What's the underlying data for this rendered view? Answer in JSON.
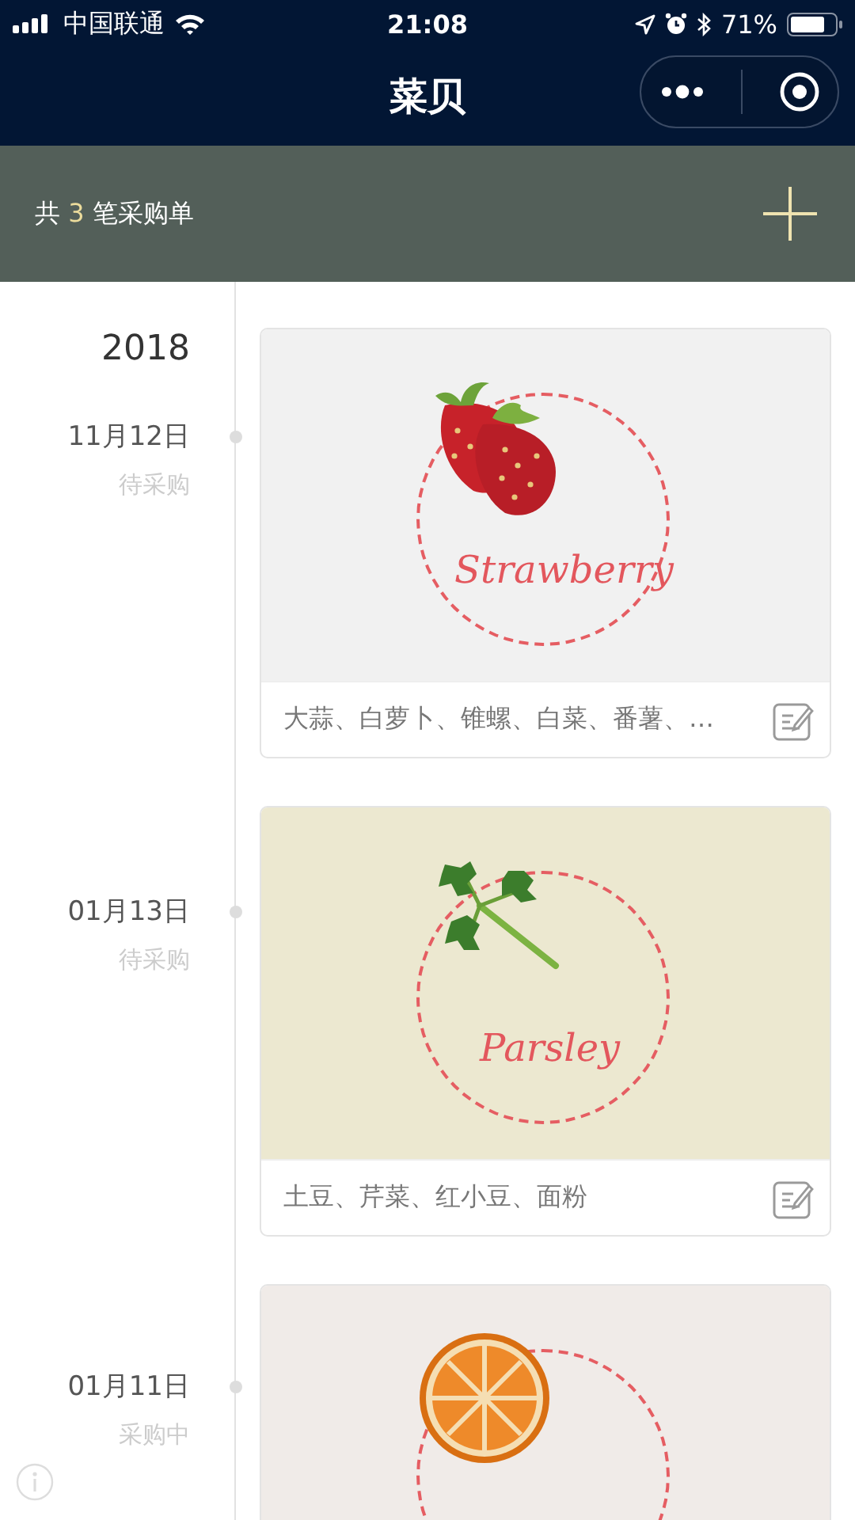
{
  "status_bar": {
    "carrier": "中国联通",
    "time": "21:08",
    "battery": "71%"
  },
  "nav": {
    "title": "菜贝"
  },
  "summary": {
    "prefix": "共",
    "count": "3",
    "suffix": "笔采购单"
  },
  "timeline": {
    "year": "2018",
    "orders": [
      {
        "date": "11月12日",
        "status": "待采购",
        "kind": "strawberry",
        "label": "Strawberry",
        "color": "#f1f1f1",
        "items": "大蒜、白萝卜、锥螺、白菜、番薯、…"
      },
      {
        "date": "01月13日",
        "status": "待采购",
        "kind": "parsley",
        "label": "Parsley",
        "color": "#ece8d0",
        "items": "土豆、芹菜、红小豆、面粉"
      },
      {
        "date": "01月11日",
        "status": "采购中",
        "kind": "orange",
        "color": "#f0ebe8"
      }
    ]
  }
}
